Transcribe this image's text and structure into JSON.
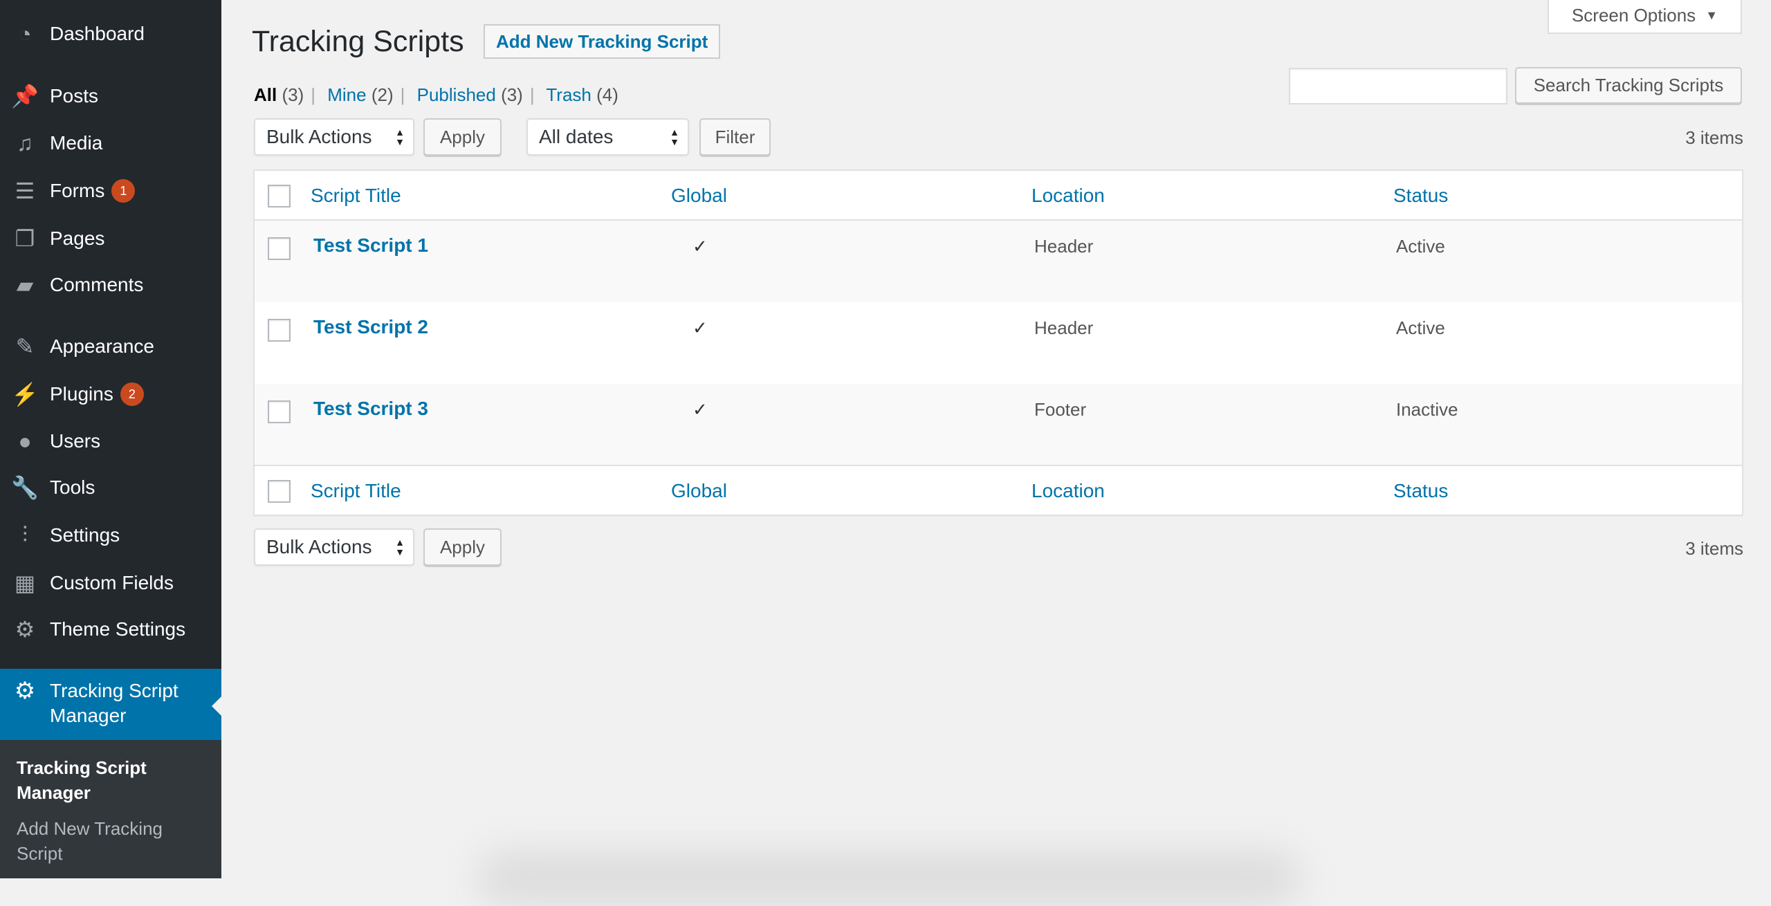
{
  "sidebar": {
    "items": [
      {
        "label": "Dashboard",
        "icon": "dashboard-icon"
      },
      {
        "label": "Posts",
        "icon": "pin-icon"
      },
      {
        "label": "Media",
        "icon": "media-icon"
      },
      {
        "label": "Forms",
        "icon": "forms-icon",
        "badge": "1"
      },
      {
        "label": "Pages",
        "icon": "pages-icon"
      },
      {
        "label": "Comments",
        "icon": "comment-icon"
      },
      {
        "label": "Appearance",
        "icon": "brush-icon"
      },
      {
        "label": "Plugins",
        "icon": "plugin-icon",
        "badge": "2"
      },
      {
        "label": "Users",
        "icon": "user-icon"
      },
      {
        "label": "Tools",
        "icon": "wrench-icon"
      },
      {
        "label": "Settings",
        "icon": "settings-icon"
      },
      {
        "label": "Custom Fields",
        "icon": "table-icon"
      },
      {
        "label": "Theme Settings",
        "icon": "gear-icon"
      }
    ],
    "active": "Tracking Script Manager",
    "submenu": [
      "Tracking Script Manager",
      "Add New Tracking Script"
    ]
  },
  "header": {
    "title": "Tracking Scripts",
    "add_new": "Add New Tracking Script",
    "screen_options": "Screen Options"
  },
  "views": [
    {
      "label": "All",
      "count": "(3)"
    },
    {
      "label": "Mine",
      "count": "(2)"
    },
    {
      "label": "Published",
      "count": "(3)"
    },
    {
      "label": "Trash",
      "count": "(4)"
    }
  ],
  "search": {
    "value": "",
    "button": "Search Tracking Scripts"
  },
  "toolbar": {
    "bulk": "Bulk Actions",
    "apply": "Apply",
    "dates": "All dates",
    "filter": "Filter",
    "count": "3 items"
  },
  "table": {
    "columns": [
      "Script Title",
      "Global",
      "Location",
      "Status"
    ],
    "rows": [
      {
        "title": "Test Script 1",
        "global": "✓",
        "location": "Header",
        "status": "Active"
      },
      {
        "title": "Test Script 2",
        "global": "✓",
        "location": "Header",
        "status": "Active"
      },
      {
        "title": "Test Script 3",
        "global": "✓",
        "location": "Footer",
        "status": "Inactive"
      }
    ]
  }
}
